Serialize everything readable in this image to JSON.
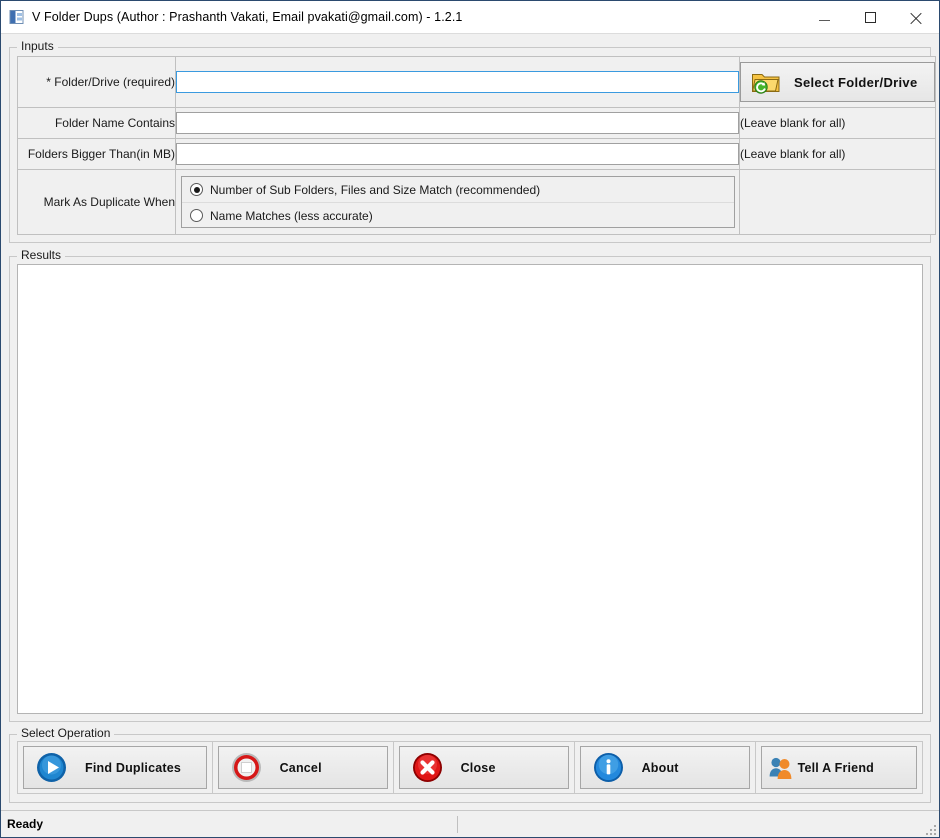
{
  "window": {
    "title": "V Folder Dups (Author : Prashanth Vakati, Email pvakati@gmail.com) - 1.2.1",
    "icon": "app-window-icon",
    "controls": {
      "minimize": "minimize-icon",
      "maximize": "maximize-icon",
      "close": "close-icon"
    }
  },
  "inputs": {
    "legend": "Inputs",
    "rows": [
      {
        "label": "* Folder/Drive (required)",
        "value": "",
        "placeholder": "",
        "focused": true,
        "action_label": "Select Folder/Drive",
        "action_icon": "folder-refresh-icon"
      },
      {
        "label": "Folder Name Contains",
        "value": "",
        "placeholder": "",
        "focused": false,
        "hint": "(Leave blank for all)"
      },
      {
        "label": "Folders Bigger Than(in MB)",
        "value": "",
        "placeholder": "",
        "focused": false,
        "hint": "(Leave blank for all)"
      }
    ],
    "duplicate_rule": {
      "label": "Mark As Duplicate When",
      "options": [
        {
          "label": "Number of Sub Folders, Files and Size Match (recommended)",
          "selected": true
        },
        {
          "label": "Name Matches (less accurate)",
          "selected": false
        }
      ]
    }
  },
  "results": {
    "legend": "Results",
    "content": ""
  },
  "operations": {
    "legend": "Select Operation",
    "buttons": [
      {
        "label": "Find Duplicates",
        "icon": "play-circle-icon"
      },
      {
        "label": "Cancel",
        "icon": "stop-circle-icon"
      },
      {
        "label": "Close",
        "icon": "close-circle-icon"
      },
      {
        "label": "About",
        "icon": "info-circle-icon"
      },
      {
        "label": "Tell A Friend",
        "icon": "two-people-icon"
      }
    ]
  },
  "statusbar": {
    "message": "Ready",
    "grip": "resize-grip-icon"
  },
  "colors": {
    "accent_focus": "#3a9adf",
    "window_border": "#2b4a6f",
    "face": "#f0f0f0",
    "play_blue": "#1278c8",
    "danger_red": "#d81a1a",
    "info_blue": "#2f93e0",
    "folder_orange": "#f0a41e"
  }
}
